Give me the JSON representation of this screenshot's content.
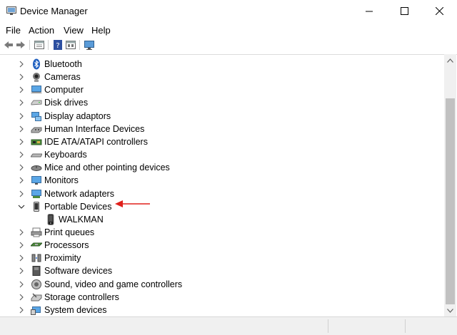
{
  "window": {
    "title": "Device Manager"
  },
  "menu": [
    "File",
    "Action",
    "View",
    "Help"
  ],
  "toolbar": [
    "back-icon",
    "forward-icon",
    "properties-icon",
    "help-icon",
    "update-driver-icon",
    "monitor-icon"
  ],
  "tree": {
    "categories": [
      {
        "label": "Bluetooth",
        "icon": "bluetooth-icon",
        "expanded": false
      },
      {
        "label": "Cameras",
        "icon": "camera-icon",
        "expanded": false
      },
      {
        "label": "Computer",
        "icon": "computer-icon",
        "expanded": false
      },
      {
        "label": "Disk drives",
        "icon": "disk-drive-icon",
        "expanded": false
      },
      {
        "label": "Display adaptors",
        "icon": "display-adaptor-icon",
        "expanded": false
      },
      {
        "label": "Human Interface Devices",
        "icon": "hid-icon",
        "expanded": false
      },
      {
        "label": "IDE ATA/ATAPI controllers",
        "icon": "ide-controller-icon",
        "expanded": false
      },
      {
        "label": "Keyboards",
        "icon": "keyboard-icon",
        "expanded": false
      },
      {
        "label": "Mice and other pointing devices",
        "icon": "mouse-icon",
        "expanded": false
      },
      {
        "label": "Monitors",
        "icon": "monitor-icon",
        "expanded": false
      },
      {
        "label": "Network adapters",
        "icon": "network-adapter-icon",
        "expanded": false
      },
      {
        "label": "Portable Devices",
        "icon": "portable-device-icon",
        "expanded": true
      },
      {
        "label": "WALKMAN",
        "icon": "walkman-icon",
        "child": true
      },
      {
        "label": "Print queues",
        "icon": "printer-icon",
        "expanded": false
      },
      {
        "label": "Processors",
        "icon": "processor-icon",
        "expanded": false
      },
      {
        "label": "Proximity",
        "icon": "proximity-icon",
        "expanded": false
      },
      {
        "label": "Software devices",
        "icon": "software-device-icon",
        "expanded": false
      },
      {
        "label": "Sound, video and game controllers",
        "icon": "sound-icon",
        "expanded": false
      },
      {
        "label": "Storage controllers",
        "icon": "storage-controller-icon",
        "expanded": false
      },
      {
        "label": "System devices",
        "icon": "system-device-icon",
        "expanded": false
      }
    ]
  },
  "colors": {
    "annotation_arrow": "#e0201b",
    "scroll_thumb": "#c1c1c1"
  }
}
